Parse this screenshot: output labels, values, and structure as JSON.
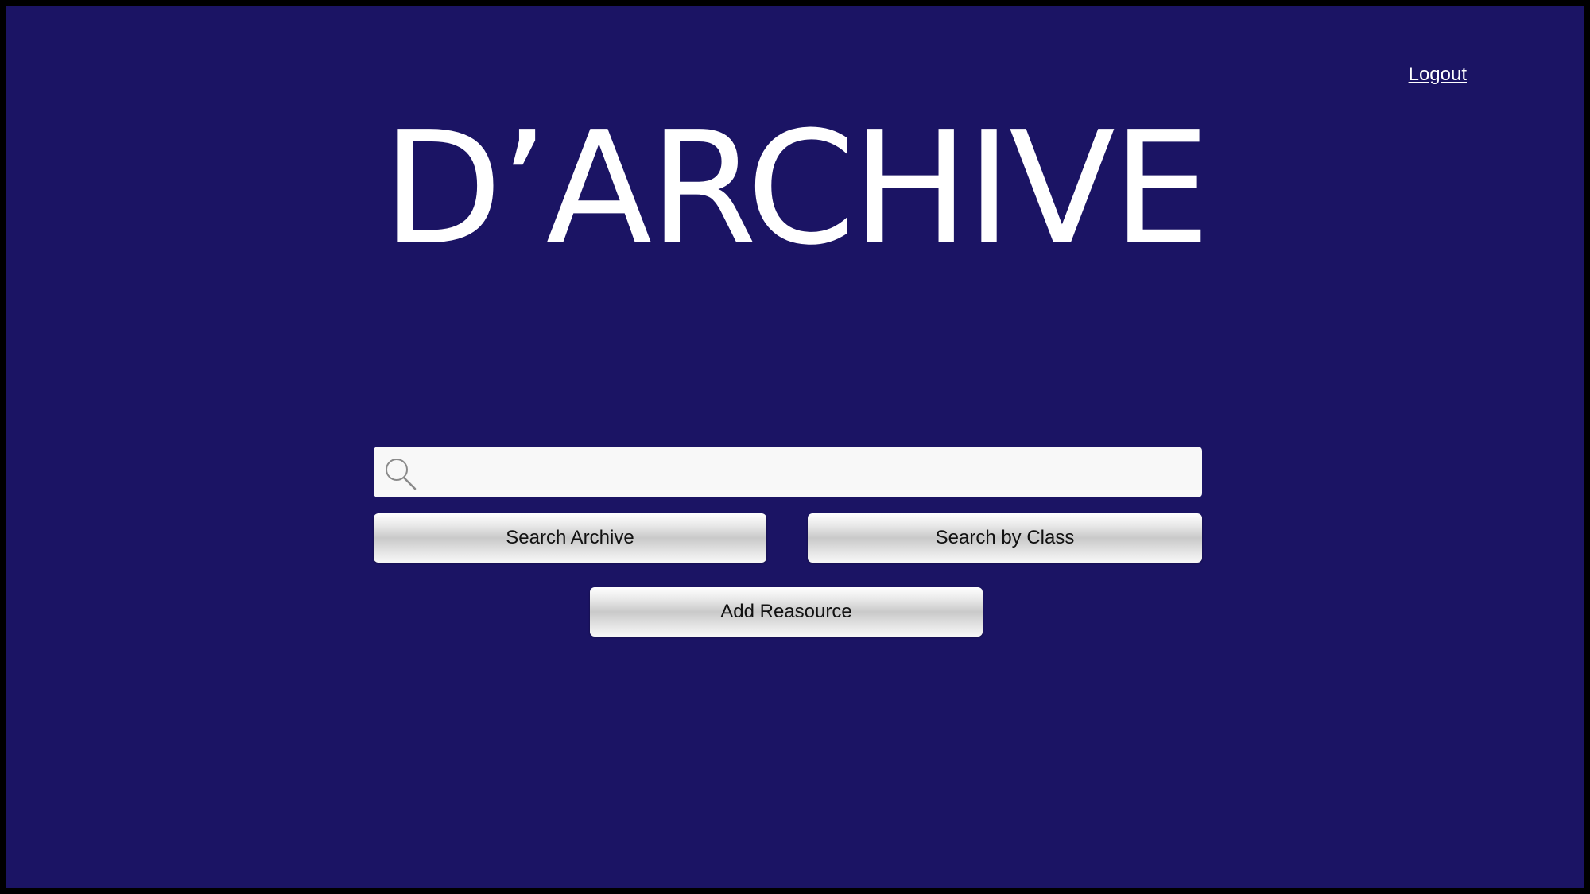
{
  "app": {
    "title": "D’ARCHIVE"
  },
  "header": {
    "logout_label": "Logout"
  },
  "search": {
    "value": "",
    "placeholder": "",
    "icon": "search-icon"
  },
  "actions": {
    "search_archive_label": "Search Archive",
    "search_by_class_label": "Search by Class",
    "add_resource_label": "Add Reasource"
  },
  "colors": {
    "background": "#1b1464",
    "border": "#000000",
    "text": "#ffffff",
    "button_text": "#111111",
    "search_box": "#f8f8f8"
  }
}
